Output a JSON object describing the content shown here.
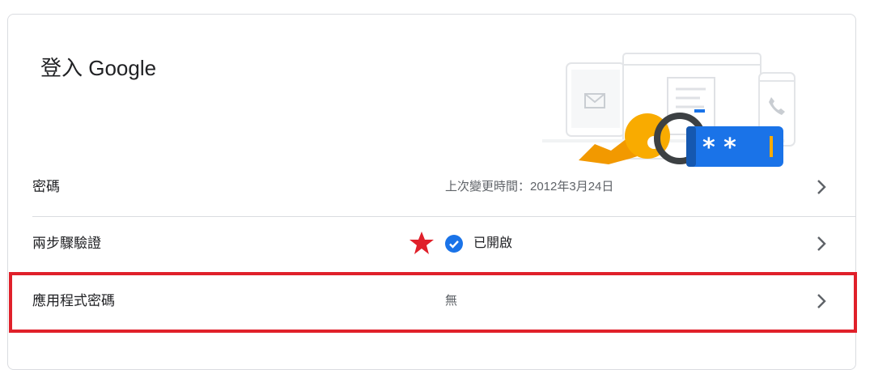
{
  "card": {
    "title": "登入 Google",
    "illustration": "password-keys-illustration"
  },
  "rows": [
    {
      "label": "密碼",
      "value": "上次變更時間：2012年3月24日"
    },
    {
      "label": "兩步驟驗證",
      "status": "已開啟",
      "status_icon": "check-circle-icon"
    },
    {
      "label": "應用程式密碼",
      "value": "無"
    }
  ],
  "annotations": {
    "star_color": "#e0202a",
    "highlight_color": "#e0202a"
  },
  "colors": {
    "accent": "#1a73e8",
    "key": "#f9ab00",
    "text": "#202124",
    "muted": "#5f6368"
  }
}
